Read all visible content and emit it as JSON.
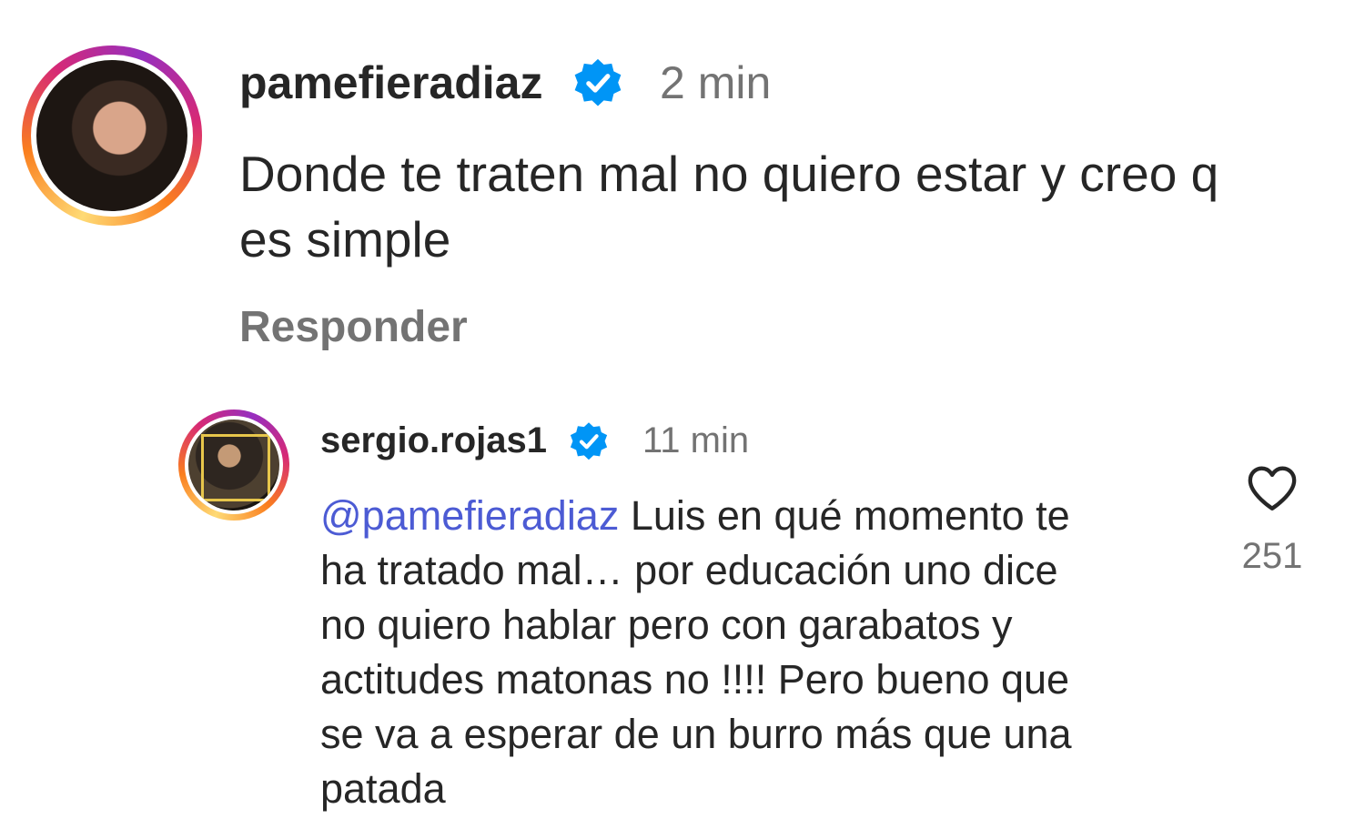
{
  "comment": {
    "username": "pamefieradiaz",
    "verified_icon": "verified-badge-icon",
    "time": "2 min",
    "text_lines": [
      "Donde  te traten mal no quiero estar y creo q",
      "es simple"
    ],
    "reply_label": "Responder"
  },
  "reply": {
    "username": "sergio.rojas1",
    "verified_icon": "verified-badge-icon",
    "time": "11 min",
    "mention": "@pamefieradiaz",
    "text_lines": [
      " Luis en qué momento te",
      "ha tratado mal… por educación uno dice",
      "no quiero hablar pero con garabatos y",
      "actitudes matonas no !!!! Pero bueno que",
      "se va a esperar de un burro más que una",
      "patada"
    ],
    "like_icon": "heart-outline-icon",
    "likes": "251"
  },
  "colors": {
    "text": "#262626",
    "secondary": "#737373",
    "mention": "#4c5bd4",
    "verified": "#0095f6"
  }
}
